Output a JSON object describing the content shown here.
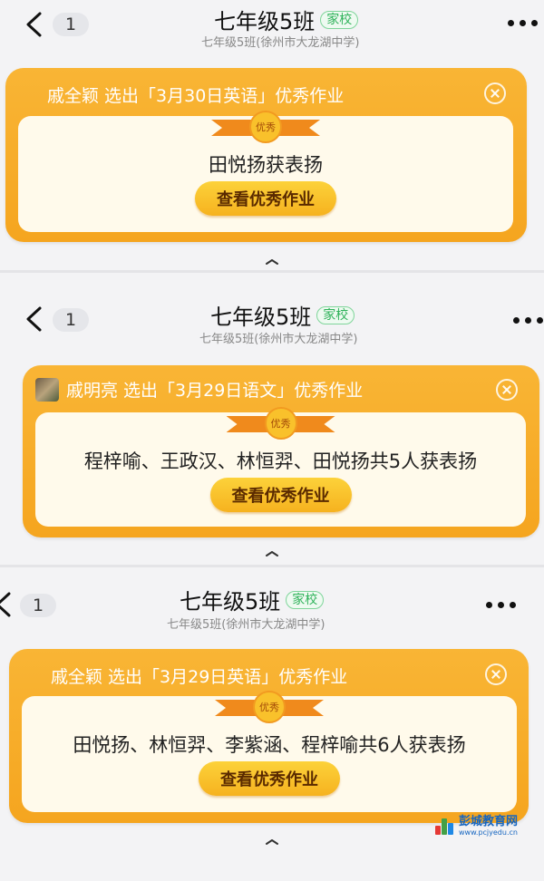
{
  "panels": [
    {
      "back_count": "1",
      "title": "七年级5班",
      "tag": "家校",
      "subtitle": "七年级5班(徐州市大龙湖中学)",
      "card_header": "戚全颖 选出「3月30日英语」优秀作业",
      "medal": "优秀",
      "praise": "田悦扬获表扬",
      "button": "查看优秀作业"
    },
    {
      "back_count": "1",
      "title": "七年级5班",
      "tag": "家校",
      "subtitle": "七年级5班(徐州市大龙湖中学)",
      "card_header": "戚明亮 选出「3月29日语文」优秀作业",
      "medal": "优秀",
      "praise": "程梓喻、王政汉、林恒羿、田悦扬共5人获表扬",
      "button": "查看优秀作业"
    },
    {
      "back_count": "1",
      "title": "七年级5班",
      "tag": "家校",
      "subtitle": "七年级5班(徐州市大龙湖中学)",
      "card_header": "戚全颖 选出「3月29日英语」优秀作业",
      "medal": "优秀",
      "praise": "田悦扬、林恒羿、李紫涵、程梓喻共6人获表扬",
      "button": "查看优秀作业"
    }
  ],
  "watermark": {
    "name": "彭城教育网",
    "url": "www.pcjyedu.cn"
  },
  "colors": {
    "card": "#f7ac29",
    "button": "#f8c02b",
    "tag_green": "#2fb25a"
  }
}
